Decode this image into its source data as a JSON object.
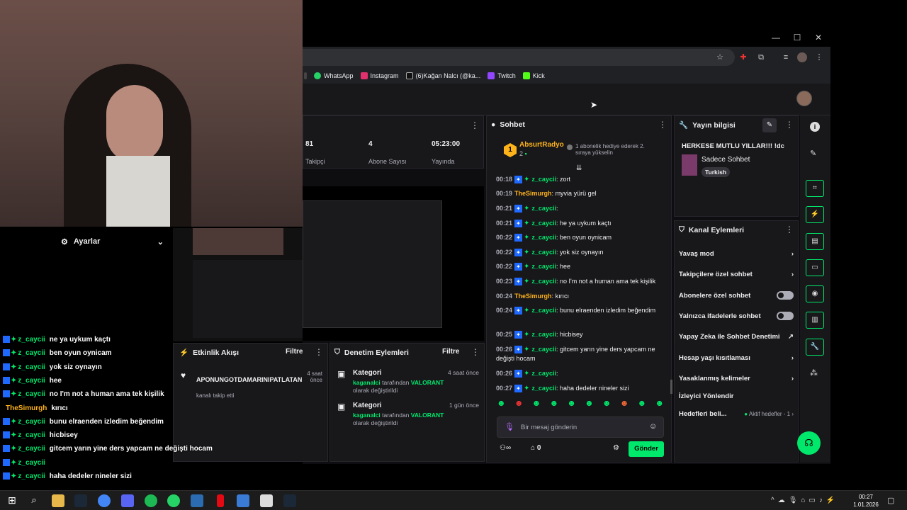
{
  "browser": {
    "bookmarks": [
      "WhatsApp",
      "Instagram",
      "(6)Kağan Nalcı (@ka...",
      "Twitch",
      "Kick"
    ]
  },
  "stats": {
    "followers_value": "81",
    "followers_label": "Takipçi",
    "subs_value": "4",
    "subs_label": "Abone Sayısı",
    "live_value": "05:23:00",
    "live_label": "Yayında"
  },
  "chat": {
    "title": "Sohbet",
    "pinned_user": "AbsurtRadyo",
    "pinned_count": "2",
    "pinned_msg": "1 abonelik hediye ederek 2. sıraya yükselin",
    "messages": [
      {
        "t": "00:18",
        "u": "z_caycii",
        "m": "zort",
        "type": "g"
      },
      {
        "t": "00:19",
        "u": "TheSimurgh",
        "m": "myvia yürü gel",
        "type": "o"
      },
      {
        "t": "00:21",
        "u": "z_caycii",
        "m": "",
        "type": "g"
      },
      {
        "t": "00:21",
        "u": "z_caycii",
        "m": "he ya uykum kaçtı",
        "type": "g"
      },
      {
        "t": "00:22",
        "u": "z_caycii",
        "m": "ben oyun oynicam",
        "type": "g"
      },
      {
        "t": "00:22",
        "u": "z_caycii",
        "m": "yok siz oynayın",
        "type": "g"
      },
      {
        "t": "00:22",
        "u": "z_caycii",
        "m": "hee",
        "type": "g"
      },
      {
        "t": "00:23",
        "u": "z_caycii",
        "m": "no I'm not a human ama tek kişilik",
        "type": "g"
      },
      {
        "t": "00:24",
        "u": "TheSimurgh",
        "m": "kırıcı",
        "type": "o"
      },
      {
        "t": "00:24",
        "u": "z_caycii",
        "m": "bunu elraenden izledim beğendim",
        "type": "g"
      },
      {
        "t": "00:25",
        "u": "z_caycii",
        "m": "hicbisey",
        "type": "g"
      },
      {
        "t": "00:26",
        "u": "z_caycii",
        "m": "gitcem yarın yine ders yapcam ne değişti hocam",
        "type": "g"
      },
      {
        "t": "00:26",
        "u": "z_caycii",
        "m": "",
        "type": "g"
      },
      {
        "t": "00:27",
        "u": "z_caycii",
        "m": "haha dedeler nineler sizi",
        "type": "g"
      }
    ],
    "input_placeholder": "Bir mesaj gönderin",
    "points": "0",
    "send_label": "Gönder"
  },
  "stream_info": {
    "title": "Yayın bilgisi",
    "stream_title": "HERKESE MUTLU YILLAR!!! !dc",
    "category": "Sadece Sohbet",
    "language": "Turkish"
  },
  "channel_actions": {
    "title": "Kanal Eylemleri",
    "items": [
      "Yavaş mod",
      "Takipçilere özel sohbet",
      "Abonelere özel sohbet",
      "Yalnızca ifadelerle sohbet",
      "Yapay Zeka ile Sohbet Denetimi",
      "Hesap yaşı kısıtlaması",
      "Yasaklanmış kelimeler",
      "İzleyici Yönlendir",
      "Hedefleri beli..."
    ],
    "goals_status": "Aktif hedefler - 1"
  },
  "activity": {
    "title": "Etkinlik Akışı",
    "filter": "Filtre",
    "user": "APONUNGOTDAMARINIPATLATAN",
    "action": "kanalı takip etti",
    "time": "4 saat önce"
  },
  "moderation": {
    "title": "Denetim Eylemleri",
    "filter": "Filtre",
    "items": [
      {
        "label": "Kategori",
        "time": "4 saat önce",
        "user": "kaganalci",
        "mid": "tarafından",
        "game": "VALORANT",
        "end": "olarak değiştirildi"
      },
      {
        "label": "Kategori",
        "time": "1 gün önce",
        "user": "kaganalci",
        "mid": "tarafından",
        "game": "VALORANT",
        "end": "olarak değiştirildi"
      }
    ]
  },
  "settings": {
    "label": "Ayarlar"
  },
  "overlay_chat": [
    {
      "u": "z_caycii",
      "m": "ne ya uykum kaçtı"
    },
    {
      "u": "z_caycii",
      "m": "ben oyun oynicam"
    },
    {
      "u": "z_caycii",
      "m": "yok siz oynayın"
    },
    {
      "u": "z_caycii",
      "m": "hee"
    },
    {
      "u": "z_caycii",
      "m": "no I'm not a human ama tek kişilik"
    },
    {
      "u": "TheSimurgh",
      "m": "kırıcı"
    },
    {
      "u": "z_caycii",
      "m": "bunu elraenden izledim beğendim"
    },
    {
      "u": "z_caycii",
      "m": "hicbisey"
    },
    {
      "u": "z_caycii",
      "m": "gitcem yarın yine ders yapcam ne değişti hocam"
    },
    {
      "u": "z_caycii",
      "m": ""
    },
    {
      "u": "z_caycii",
      "m": "haha dedeler nineler sizi"
    }
  ],
  "clock": {
    "time": "00:27",
    "date": "1.01.2026"
  },
  "colors": {
    "accent": "#00e86b",
    "badge": "#1f69ff",
    "gold": "#ffb31a"
  }
}
